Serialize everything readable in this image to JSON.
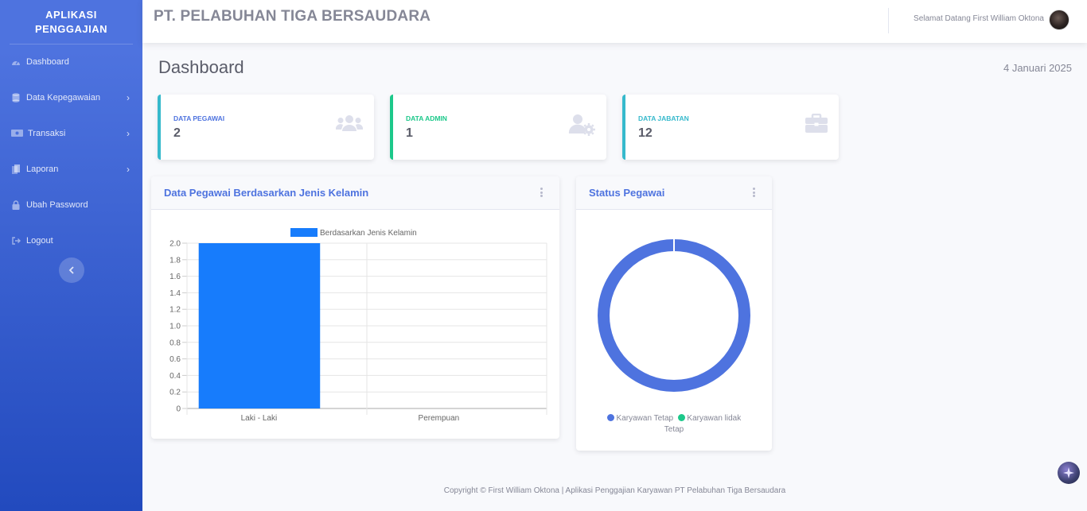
{
  "sidebar": {
    "brand_line1": "APLIKASI",
    "brand_line2": "PENGGAJIAN",
    "items": [
      {
        "label": "Dashboard",
        "icon": "dashboard-icon",
        "has_children": false
      },
      {
        "label": "Data Kepegawaian",
        "icon": "database-icon",
        "has_children": true
      },
      {
        "label": "Transaksi",
        "icon": "money-icon",
        "has_children": true
      },
      {
        "label": "Laporan",
        "icon": "copy-icon",
        "has_children": true
      },
      {
        "label": "Ubah Password",
        "icon": "lock-icon",
        "has_children": false
      },
      {
        "label": "Logout",
        "icon": "sign-out-icon",
        "has_children": false
      }
    ],
    "toggle_icon": "chevron-left-icon"
  },
  "topbar": {
    "company": "PT. PELABUHAN TIGA BERSAUDARA",
    "welcome": "Selamat Datang First William Oktona"
  },
  "page": {
    "title": "Dashboard",
    "date": "4 Januari 2025"
  },
  "stats": [
    {
      "label": "DATA PEGAWAI",
      "value": "2",
      "color": "#4e73df",
      "icon": "users-icon"
    },
    {
      "label": "DATA ADMIN",
      "value": "1",
      "color": "#1cc88a",
      "icon": "user-cog-icon"
    },
    {
      "label": "DATA JABATAN",
      "value": "12",
      "color": "#36b9cc",
      "icon": "briefcase-icon"
    }
  ],
  "colors": {
    "primary": "#4e73df",
    "success": "#1cc88a",
    "info": "#36b9cc",
    "bar": "#177cfc"
  },
  "bar_panel": {
    "title": "Data Pegawai Berdasarkan Jenis Kelamin"
  },
  "donut_panel": {
    "title": "Status Pegawai"
  },
  "chart_data": [
    {
      "type": "bar",
      "title": "",
      "categories": [
        "Laki - Laki",
        "Perempuan"
      ],
      "series": [
        {
          "name": "Berdasarkan Jenis Kelamin",
          "values": [
            2,
            0
          ]
        }
      ],
      "ylim": [
        0,
        2.0
      ],
      "yticks": [
        "2.0",
        "1.8",
        "1.6",
        "1.4",
        "1.2",
        "1.0",
        "0.8",
        "0.6",
        "0.4",
        "0.2",
        "0"
      ],
      "grid": true,
      "legend": "top"
    },
    {
      "type": "pie",
      "variant": "donut",
      "labels": [
        "Karyawan Tetap",
        "Karyawan lidak Tetap"
      ],
      "legend_line1": "Karyawan Tetap",
      "legend_line2a": "Karyawan lidak",
      "legend_line2b": "Tetap",
      "values": [
        2,
        0
      ],
      "colors": [
        "#4e73df",
        "#1cc88a"
      ],
      "legend": "bottom"
    }
  ],
  "footer": {
    "text": "Copyright © First William Oktona | Aplikasi Penggajian Karyawan PT Pelabuhan Tiga Bersaudara"
  }
}
